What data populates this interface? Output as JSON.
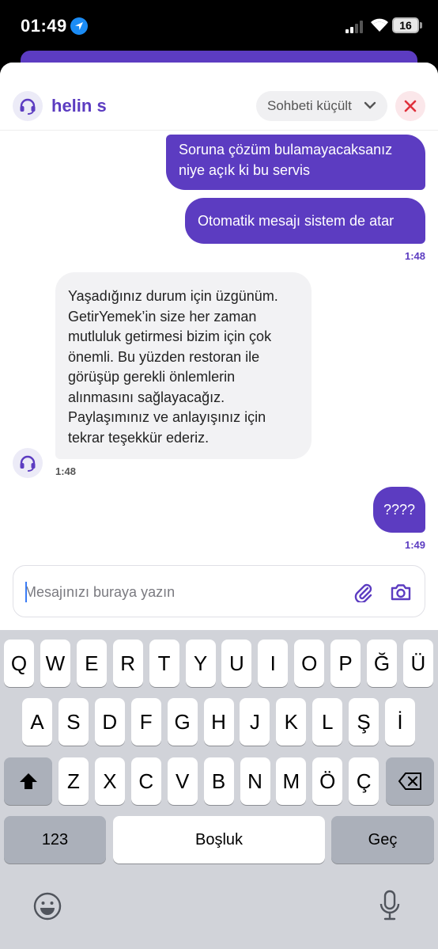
{
  "status_bar": {
    "time": "01:49",
    "battery": "16"
  },
  "header": {
    "agent_name": "helin s",
    "minimize_label": "Sohbeti küçült"
  },
  "messages": [
    {
      "id": "m1",
      "direction": "out",
      "lines": [
        "Soruna çözüm bulamayacaksanız",
        "niye açık ki bu servis"
      ]
    },
    {
      "id": "m2",
      "direction": "out",
      "lines": [
        "Otomatik mesajı sistem de atar"
      ],
      "time": "1:48"
    },
    {
      "id": "m3",
      "direction": "in",
      "lines": [
        "Yaşadığınız durum için üzgünüm.",
        "GetirYemek’in size her zaman",
        "mutluluk getirmesi bizim için çok",
        "önemli. Bu yüzden restoran ile",
        "görüşüp gerekli önlemlerin",
        "alınmasını sağlayacağız.",
        "Paylaşımınız ve anlayışınız için",
        "tekrar teşekkür ederiz."
      ],
      "time": "1:48"
    },
    {
      "id": "m4",
      "direction": "out",
      "lines": [
        "????"
      ],
      "time": "1:49"
    }
  ],
  "composer": {
    "placeholder": "Mesajınızı buraya yazın"
  },
  "keyboard": {
    "row1": [
      "Q",
      "W",
      "E",
      "R",
      "T",
      "Y",
      "U",
      "I",
      "O",
      "P",
      "Ğ",
      "Ü"
    ],
    "row2": [
      "A",
      "S",
      "D",
      "F",
      "G",
      "H",
      "J",
      "K",
      "L",
      "Ş",
      "İ"
    ],
    "row3": [
      "Z",
      "X",
      "C",
      "V",
      "B",
      "N",
      "M",
      "Ö",
      "Ç"
    ],
    "numbers_label": "123",
    "space_label": "Boşluk",
    "return_label": "Geç"
  },
  "colors": {
    "brand": "#5c3cc1",
    "close_red": "#e0303b"
  }
}
